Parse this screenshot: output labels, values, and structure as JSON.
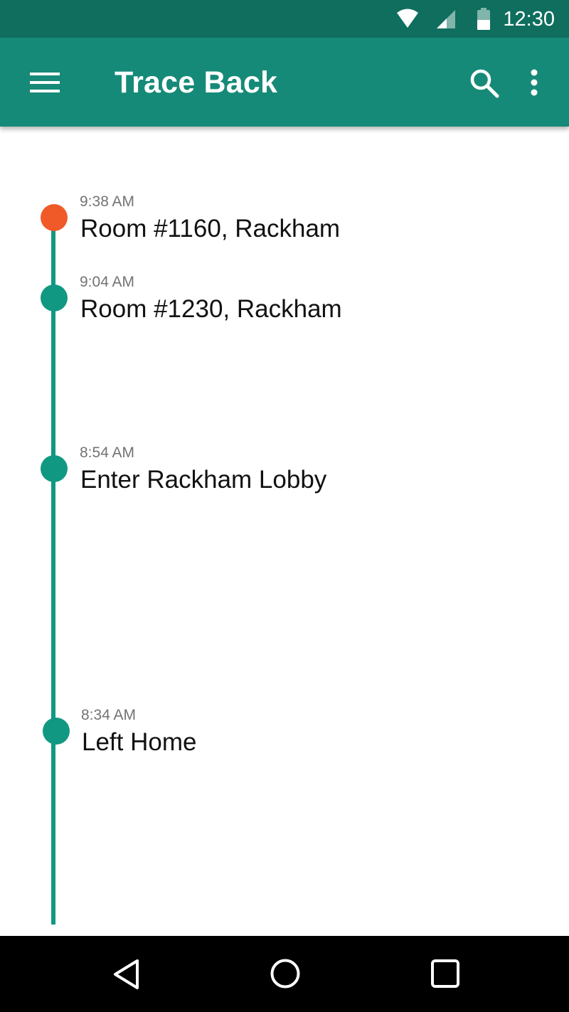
{
  "status_bar": {
    "time": "12:30",
    "icons": [
      "wifi-icon",
      "signal-icon",
      "battery-icon"
    ]
  },
  "app_bar": {
    "title": "Trace Back",
    "icons": [
      "menu-icon",
      "search-icon",
      "more-vert-icon"
    ]
  },
  "colors": {
    "status_bar": "#0f6e5e",
    "app_bar": "#168a78",
    "timeline": "#119882",
    "current_dot": "#f05a28",
    "past_dot": "#119882"
  },
  "timeline": [
    {
      "time": "9:38 AM",
      "place": "Room #1160, Rackham",
      "current": true
    },
    {
      "time": "9:04 AM",
      "place": "Room #1230, Rackham",
      "current": false
    },
    {
      "time": "8:54 AM",
      "place": "Enter Rackham Lobby",
      "current": false
    },
    {
      "time": "8:34 AM",
      "place": "Left Home",
      "current": false
    }
  ],
  "nav_bar": {
    "icons": [
      "back-icon",
      "home-icon",
      "recents-icon"
    ]
  }
}
